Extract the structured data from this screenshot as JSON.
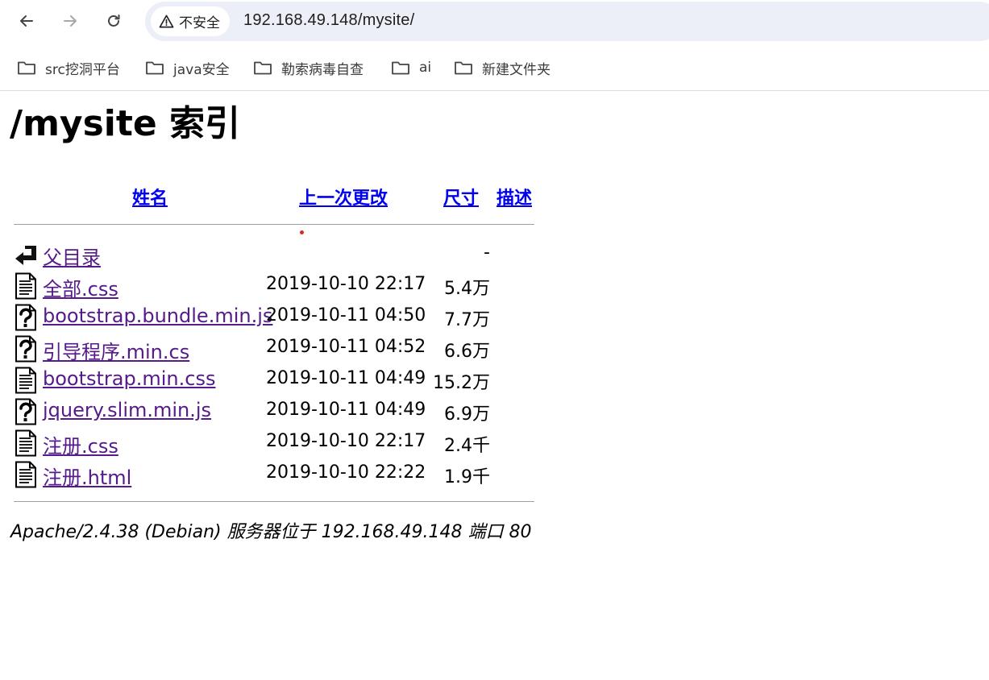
{
  "browser": {
    "security_label": "不安全",
    "url": "192.168.49.148/mysite/",
    "bookmarks": [
      {
        "label": "src挖洞平台",
        "icon": "folder-icon"
      },
      {
        "label": "java安全",
        "icon": "folder-icon"
      },
      {
        "label": "勒索病毒自查",
        "icon": "folder-icon"
      },
      {
        "label": "ai",
        "icon": "folder-icon"
      },
      {
        "label": "新建文件夹",
        "icon": "folder-icon"
      }
    ]
  },
  "page": {
    "title": "/mysite 索引",
    "columns": {
      "name": "姓名",
      "last_modified": "上一次更改",
      "size": "尺寸",
      "description": "描述"
    },
    "rows": [
      {
        "icon": "back-arrow-icon",
        "name": "父目录",
        "date": "",
        "size": "-"
      },
      {
        "icon": "text-file-icon",
        "name": "全部.css",
        "date": "2019-10-10 22:17",
        "size": "5.4万"
      },
      {
        "icon": "unknown-file-icon",
        "name": "bootstrap.bundle.min.js",
        "date": "2019-10-11 04:50",
        "size": "7.7万"
      },
      {
        "icon": "unknown-file-icon",
        "name": "引导程序.min.cs",
        "date": "2019-10-11 04:52",
        "size": "6.6万"
      },
      {
        "icon": "text-file-icon",
        "name": "bootstrap.min.css",
        "date": "2019-10-11 04:49",
        "size": "15.2万"
      },
      {
        "icon": "unknown-file-icon",
        "name": "jquery.slim.min.js",
        "date": "2019-10-11 04:49",
        "size": "6.9万"
      },
      {
        "icon": "text-file-icon",
        "name": "注册.css",
        "date": "2019-10-10 22:17",
        "size": "2.4千"
      },
      {
        "icon": "text-file-icon",
        "name": "注册.html",
        "date": "2019-10-10 22:22",
        "size": "1.9千"
      }
    ],
    "footer": "Apache/2.4.38 (Debian) 服务器位于 192.168.49.148 端口 80"
  }
}
